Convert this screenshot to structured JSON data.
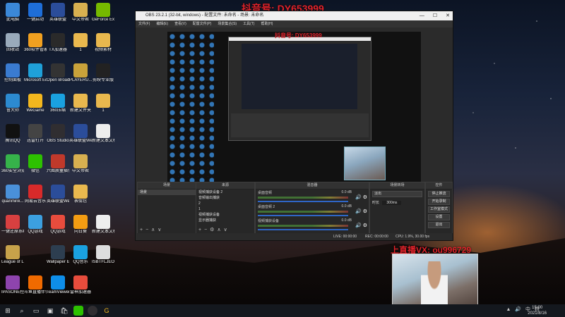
{
  "watermarks": {
    "top_prefix": "抖音号:",
    "top_id": "DY653999",
    "mid": "抖音号: DY653999",
    "bottom": "上直播VX: ou996729"
  },
  "desktop_icons": [
    {
      "label": "此电脑",
      "col": 0,
      "row": 0,
      "color": "#3b88d8"
    },
    {
      "label": "一键启动",
      "col": 1,
      "row": 0,
      "color": "#1e6ed8"
    },
    {
      "label": "英雄联盟",
      "col": 2,
      "row": 0,
      "color": "#2b4d9a"
    },
    {
      "label": "中文帝君",
      "col": 3,
      "row": 0,
      "color": "#d8b050"
    },
    {
      "label": "GeForce Experience",
      "col": 4,
      "row": 0,
      "color": "#76b900"
    },
    {
      "label": "回收站",
      "col": 0,
      "row": 1,
      "color": "#9ab"
    },
    {
      "label": "360软件管家",
      "col": 1,
      "row": 1,
      "color": "#f0a020"
    },
    {
      "label": "TX加速器",
      "col": 2,
      "row": 1,
      "color": "#2a2a2a"
    },
    {
      "label": "1",
      "col": 3,
      "row": 1,
      "color": "#e9b84e"
    },
    {
      "label": "视频素材",
      "col": 4,
      "row": 1,
      "color": "#e9b84e"
    },
    {
      "label": "控制面板",
      "col": 0,
      "row": 2,
      "color": "#3a7bd0"
    },
    {
      "label": "Microsoft Edge",
      "col": 1,
      "row": 2,
      "color": "#1fa0d8"
    },
    {
      "label": "Open Broadcast...",
      "col": 2,
      "row": 2,
      "color": "#333"
    },
    {
      "label": "PLAYERU... BATTLEGR...",
      "col": 3,
      "row": 2,
      "color": "#c9a23a"
    },
    {
      "label": "剪映专业版",
      "col": 4,
      "row": 2,
      "color": "#222"
    },
    {
      "label": "鲁大师",
      "col": 0,
      "row": 3,
      "color": "#2c8ad0"
    },
    {
      "label": "WeGame",
      "col": 1,
      "row": 3,
      "color": "#f3b71e"
    },
    {
      "label": "360压缩",
      "col": 2,
      "row": 3,
      "color": "#1aa1e0"
    },
    {
      "label": "新建文件夹",
      "col": 3,
      "row": 3,
      "color": "#e9b84e"
    },
    {
      "label": "1",
      "col": 4,
      "row": 3,
      "color": "#e9b84e"
    },
    {
      "label": "腾讯QQ",
      "col": 0,
      "row": 4,
      "color": "#111"
    },
    {
      "label": "迅雷打开",
      "col": 1,
      "row": 4,
      "color": "#444"
    },
    {
      "label": "OBS Studio",
      "col": 2,
      "row": 4,
      "color": "#302e31"
    },
    {
      "label": "英雄联盟WeGame版",
      "col": 3,
      "row": 4,
      "color": "#2b4d9a"
    },
    {
      "label": "新建文本文档",
      "col": 4,
      "row": 4,
      "color": "#eee"
    },
    {
      "label": "360安全浏览器",
      "col": 0,
      "row": 5,
      "color": "#36b34a"
    },
    {
      "label": "微信",
      "col": 1,
      "row": 5,
      "color": "#2dc100"
    },
    {
      "label": "六图质量插件组",
      "col": 2,
      "row": 5,
      "color": "#c0392b"
    },
    {
      "label": "中文帝君",
      "col": 3,
      "row": 5,
      "color": "#d8b050"
    },
    {
      "label": "quanmink...",
      "col": 0,
      "row": 6,
      "color": "#4a90d9"
    },
    {
      "label": "网易云音乐",
      "col": 1,
      "row": 6,
      "color": "#d82a2a"
    },
    {
      "label": "英雄联盟WeGame版",
      "col": 2,
      "row": 6,
      "color": "#2b4d9a"
    },
    {
      "label": "表情包",
      "col": 3,
      "row": 6,
      "color": "#e9b84e"
    },
    {
      "label": "一键还原系统",
      "col": 0,
      "row": 7,
      "color": "#d84040"
    },
    {
      "label": "QQ游戏",
      "col": 1,
      "row": 7,
      "color": "#3ca0e0"
    },
    {
      "label": "QQ游戏",
      "col": 2,
      "row": 7,
      "color": "#e84c3d"
    },
    {
      "label": "向日葵",
      "col": 3,
      "row": 7,
      "color": "#f39c12"
    },
    {
      "label": "新建文本文档 (2)",
      "col": 4,
      "row": 7,
      "color": "#eee"
    },
    {
      "label": "League of Legends",
      "col": 0,
      "row": 8,
      "color": "#c8a24a"
    },
    {
      "label": "Wallpaper Engine",
      "col": 2,
      "row": 8,
      "color": "#2d3e50"
    },
    {
      "label": "QQ音乐",
      "col": 3,
      "row": 8,
      "color": "#1aa1e0"
    },
    {
      "label": "ISBTFLJEO...",
      "col": 4,
      "row": 8,
      "color": "#ddd"
    },
    {
      "label": "IPASONE控制软件",
      "col": 0,
      "row": 9,
      "color": "#8e44ad"
    },
    {
      "label": "斗鱼直播伴侣",
      "col": 1,
      "row": 9,
      "color": "#f06a00"
    },
    {
      "label": "TeamViewer",
      "col": 2,
      "row": 9,
      "color": "#0e8ee9"
    },
    {
      "label": "雷神加速器",
      "col": 3,
      "row": 9,
      "color": "#e74c3c"
    }
  ],
  "obs": {
    "title": "OBS 23.2.1 (32-bit, windows) - 配置文件: 未命名 - 场景: 未命名",
    "menu": [
      "文件(F)",
      "编辑(E)",
      "查看(V)",
      "配置文件(P)",
      "场景集合(S)",
      "工具(T)",
      "帮助(H)"
    ],
    "docks": {
      "scenes": {
        "title": "场景",
        "items": [
          "场景"
        ]
      },
      "sources": {
        "title": "来源",
        "items": [
          "视频捕获设备 2",
          "音频输出捕获",
          "2",
          "1",
          "视频捕获设备",
          "显示器捕获"
        ]
      },
      "mixer": {
        "title": "混音器",
        "channels": [
          {
            "name": "桌面音频",
            "db": "0.0 dB"
          },
          {
            "name": "桌面音频 2",
            "db": "0.0 dB"
          },
          {
            "name": "视频捕获设备",
            "db": "0.0 dB"
          }
        ]
      },
      "transitions": {
        "title": "场景转场",
        "type": "淡出",
        "duration_label": "时长",
        "duration": "300ms"
      },
      "controls": {
        "title": "控件",
        "buttons": [
          "停止推流",
          "开始录制",
          "工作室模式",
          "设置",
          "退出"
        ]
      }
    },
    "status": {
      "live": "LIVE: 00:00:00",
      "rec": "REC: 00:00:00",
      "cpu": "CPU: 1.9%, 30.00 fps"
    }
  },
  "taskbar": {
    "time": "15:00",
    "date": "2021/8/16",
    "tray": "▲ 🔊 中 拼"
  },
  "colors": {
    "watermark": "#e0222a",
    "obs_bg": "#2b2b2b",
    "dock_bg": "#272727",
    "accent_blue": "#2f66c6"
  }
}
